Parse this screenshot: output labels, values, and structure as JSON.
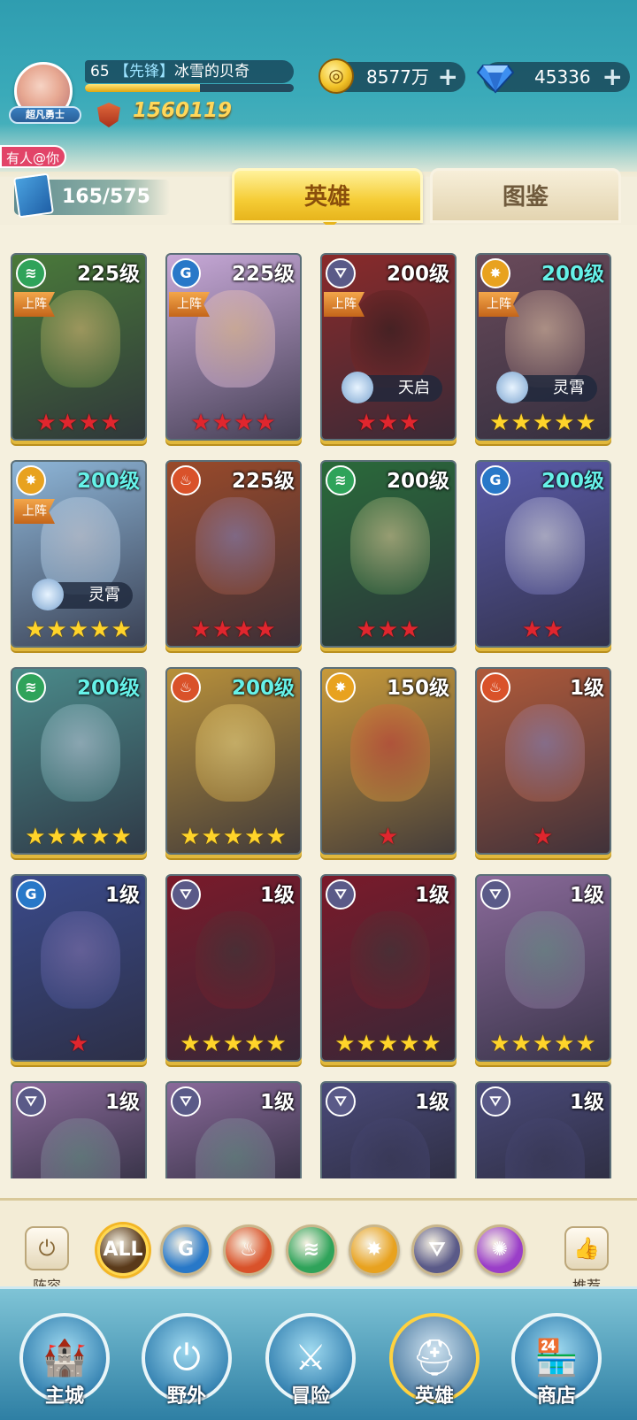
{
  "header": {
    "avatar_badge": "超凡勇士",
    "level": "65",
    "rank_tag": "【先锋】",
    "player_name": "冰雪的贝奇",
    "xp_progress": 0.55,
    "power": "1560119",
    "gold": "8577万",
    "diamonds": "45336",
    "plus": "+"
  },
  "notice": "有人@你",
  "hero_count": "165/575",
  "tabs": {
    "heroes": "英雄",
    "encyclopedia": "图鉴"
  },
  "deploy_label": "上阵",
  "element_colors": {
    "wind": "#2fa35a",
    "water": "#2878c8",
    "fire": "#d9522a",
    "light": "#e8a21f",
    "dark": "#5a5a88",
    "arcane": "#9a3ec8"
  },
  "heroes": [
    {
      "level": "225级",
      "element": "wind",
      "deployed": true,
      "stars": 4,
      "star_color": "r",
      "awaken": "",
      "lvl_cyan": false,
      "bg": "#4a7a3a",
      "face": "#e8c47a"
    },
    {
      "level": "225级",
      "element": "water",
      "deployed": true,
      "stars": 4,
      "star_color": "r",
      "awaken": "",
      "lvl_cyan": false,
      "bg": "#c8a9d8",
      "face": "#f3c98f"
    },
    {
      "level": "200级",
      "element": "dark",
      "deployed": true,
      "stars": 3,
      "star_color": "r",
      "awaken": "天启",
      "lvl_cyan": false,
      "bg": "#8a2a2a",
      "face": "#2a1a1a"
    },
    {
      "level": "200级",
      "element": "light",
      "deployed": true,
      "stars": 5,
      "star_color": "y",
      "awaken": "灵霄",
      "lvl_cyan": true,
      "bg": "#6a4a5a",
      "face": "#f2d0b0"
    },
    {
      "level": "200级",
      "element": "light",
      "deployed": true,
      "stars": 5,
      "star_color": "y",
      "awaken": "灵霄",
      "lvl_cyan": true,
      "bg": "#8eb6d8",
      "face": "#d8d8e0"
    },
    {
      "level": "225级",
      "element": "fire",
      "deployed": false,
      "stars": 4,
      "star_color": "r",
      "awaken": "",
      "lvl_cyan": false,
      "bg": "#9a4a2a",
      "face": "#8a8ac8"
    },
    {
      "level": "200级",
      "element": "wind",
      "deployed": false,
      "stars": 3,
      "star_color": "r",
      "awaken": "",
      "lvl_cyan": false,
      "bg": "#2a6a3a",
      "face": "#f0d9a0"
    },
    {
      "level": "200级",
      "element": "water",
      "deployed": false,
      "stars": 2,
      "star_color": "r",
      "awaken": "",
      "lvl_cyan": true,
      "bg": "#5a5aa8",
      "face": "#f0f0f0"
    },
    {
      "level": "200级",
      "element": "wind",
      "deployed": false,
      "stars": 5,
      "star_color": "y",
      "awaken": "",
      "lvl_cyan": true,
      "bg": "#4a8a8a",
      "face": "#c8d8e8"
    },
    {
      "level": "200级",
      "element": "fire",
      "deployed": false,
      "stars": 5,
      "star_color": "y",
      "awaken": "",
      "lvl_cyan": true,
      "bg": "#b8903a",
      "face": "#f6e08a"
    },
    {
      "level": "150级",
      "element": "light",
      "deployed": false,
      "stars": 1,
      "star_color": "r",
      "awaken": "",
      "lvl_cyan": false,
      "bg": "#c89a3a",
      "face": "#c83a3a"
    },
    {
      "level": "1级",
      "element": "fire",
      "deployed": false,
      "stars": 1,
      "star_color": "r",
      "awaken": "",
      "lvl_cyan": false,
      "bg": "#b05a3a",
      "face": "#8a8ac8"
    },
    {
      "level": "1级",
      "element": "water",
      "deployed": false,
      "stars": 1,
      "star_color": "r",
      "awaken": "",
      "lvl_cyan": false,
      "bg": "#3a4a8a",
      "face": "#8a7ab8"
    },
    {
      "level": "1级",
      "element": "dark",
      "deployed": false,
      "stars": 5,
      "star_color": "y",
      "awaken": "",
      "lvl_cyan": false,
      "bg": "#7a1a2a",
      "face": "#3a3a3a"
    },
    {
      "level": "1级",
      "element": "dark",
      "deployed": false,
      "stars": 5,
      "star_color": "y",
      "awaken": "",
      "lvl_cyan": false,
      "bg": "#7a1a2a",
      "face": "#3a3a3a"
    },
    {
      "level": "1级",
      "element": "dark",
      "deployed": false,
      "stars": 5,
      "star_color": "y",
      "awaken": "",
      "lvl_cyan": false,
      "bg": "#8a6a9a",
      "face": "#6a9a8a"
    },
    {
      "level": "1级",
      "element": "dark",
      "deployed": false,
      "stars": 0,
      "star_color": "y",
      "awaken": "",
      "lvl_cyan": false,
      "bg": "#8a6a9a",
      "face": "#6a9a8a"
    },
    {
      "level": "1级",
      "element": "dark",
      "deployed": false,
      "stars": 0,
      "star_color": "y",
      "awaken": "",
      "lvl_cyan": false,
      "bg": "#8a6a9a",
      "face": "#6a9a8a"
    },
    {
      "level": "1级",
      "element": "dark",
      "deployed": false,
      "stars": 0,
      "star_color": "y",
      "awaken": "",
      "lvl_cyan": false,
      "bg": "#4a4a7a",
      "face": "#3a3a5a"
    },
    {
      "level": "1级",
      "element": "dark",
      "deployed": false,
      "stars": 0,
      "star_color": "y",
      "awaken": "",
      "lvl_cyan": false,
      "bg": "#4a4a7a",
      "face": "#3a3a5a"
    }
  ],
  "filters": [
    {
      "id": "all",
      "label": "ALL"
    },
    {
      "id": "water",
      "label": ""
    },
    {
      "id": "fire",
      "label": ""
    },
    {
      "id": "wind",
      "label": ""
    },
    {
      "id": "light",
      "label": ""
    },
    {
      "id": "dark",
      "label": ""
    },
    {
      "id": "arcane",
      "label": ""
    }
  ],
  "side_buttons": {
    "lineup": "阵容",
    "recommend": "推荐"
  },
  "bottom_nav": [
    {
      "label": "主城",
      "icon": "castle-icon"
    },
    {
      "label": "野外",
      "icon": "portal-icon"
    },
    {
      "label": "冒险",
      "icon": "sword-icon"
    },
    {
      "label": "英雄",
      "icon": "helmet-icon",
      "active": true
    },
    {
      "label": "商店",
      "icon": "shop-icon"
    }
  ]
}
